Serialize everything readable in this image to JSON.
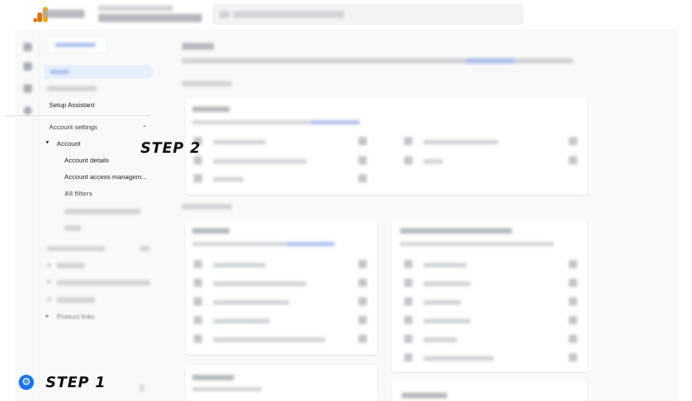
{
  "nav": {
    "setup_assistant": "Setup Assistant",
    "account_settings": "Account settings",
    "account": "Account",
    "account_details": "Account details",
    "account_access": "Account access managem...",
    "all_filters": "All filters",
    "product_links": "Product links"
  },
  "annotations": {
    "step1": "STEP 1",
    "step2": "STEP 2"
  },
  "icons": {
    "settings": "gear-icon",
    "collapse": "chevron-up-icon",
    "expand": "triangle-down-icon",
    "collapsed": "triangle-right-icon"
  },
  "colors": {
    "accent": "#1a73e8",
    "active_bg": "#e8f0fe",
    "logo_primary": "#f9ab00",
    "logo_secondary": "#e37400"
  }
}
